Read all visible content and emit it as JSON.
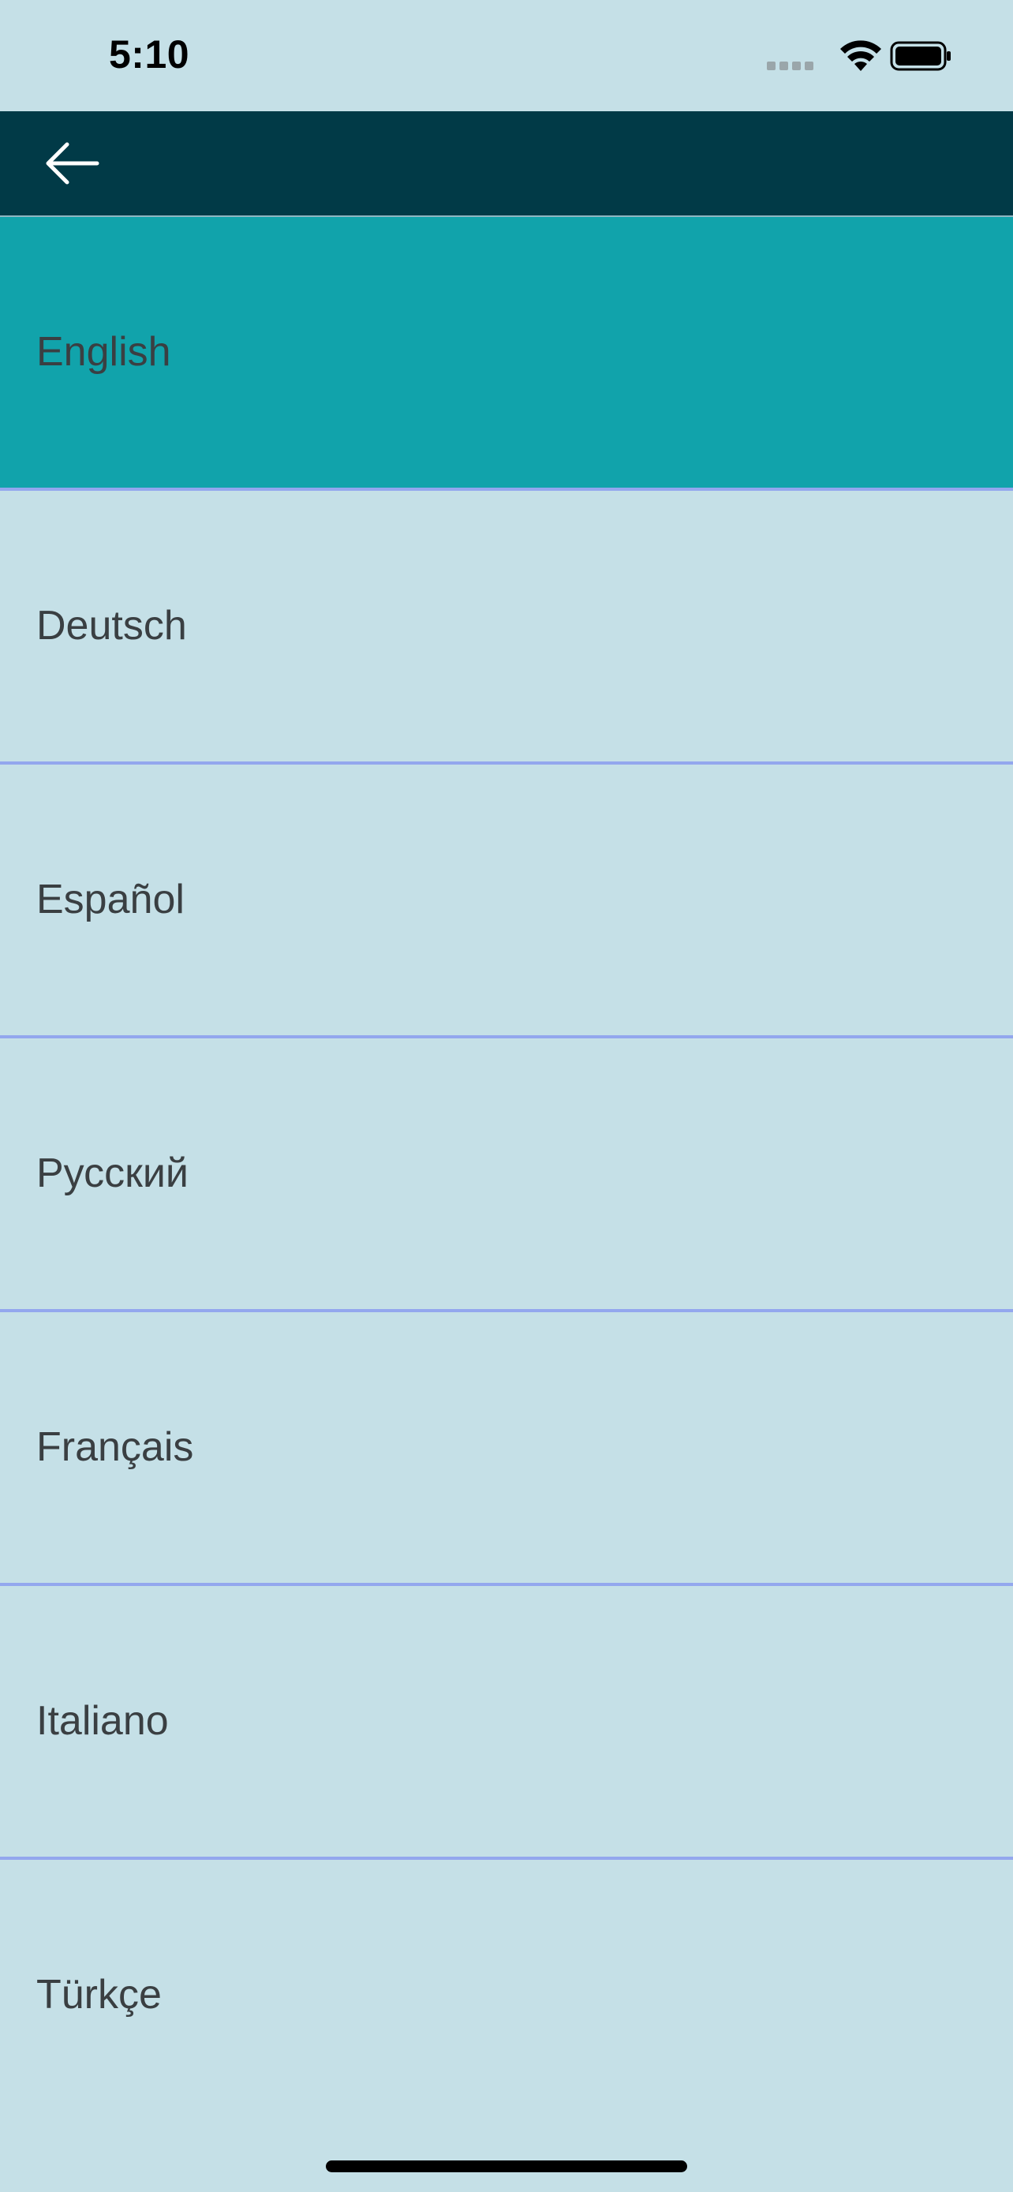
{
  "status_bar": {
    "time": "5:10"
  },
  "app_bar": {
    "back_icon": "arrow-left-icon",
    "colors": {
      "background": "#013a47",
      "icon": "#ffffff"
    }
  },
  "languages": [
    {
      "label": "English",
      "selected": true
    },
    {
      "label": "Deutsch",
      "selected": false
    },
    {
      "label": "Español",
      "selected": false
    },
    {
      "label": "Русский",
      "selected": false
    },
    {
      "label": "Français",
      "selected": false
    },
    {
      "label": "Italiano",
      "selected": false
    },
    {
      "label": "Türkçe",
      "selected": false
    }
  ],
  "colors": {
    "page_background": "#c5e0e7",
    "selected_row": "#11a3ab",
    "divider": "#93a7ee",
    "text": "#3a3f42"
  }
}
